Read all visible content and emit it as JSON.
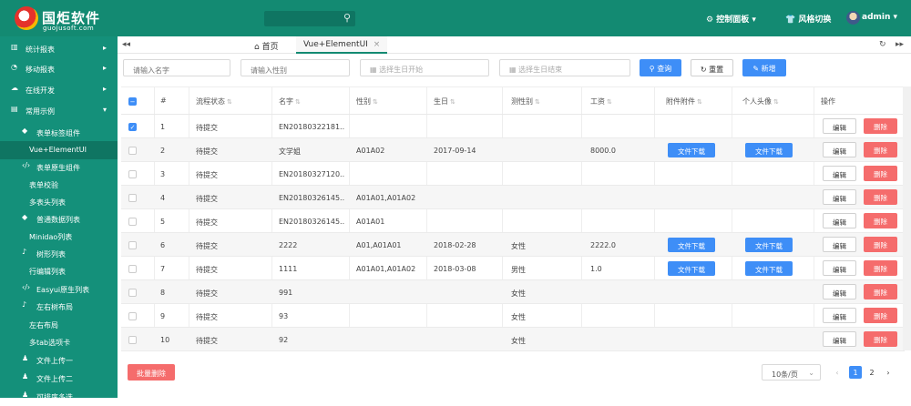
{
  "header": {
    "brand": "国炬软件",
    "brand_sub": "guojusoft.com",
    "search_placeholder": "",
    "control_panel": "控制面板",
    "theme_switch": "风格切换",
    "user": "admin"
  },
  "sidebar": {
    "items": [
      {
        "label": "统计报表",
        "icon": "bar-chart-icon",
        "arrow": "▸"
      },
      {
        "label": "移动报表",
        "icon": "pie-chart-icon",
        "arrow": "▸"
      },
      {
        "label": "在线开发",
        "icon": "cloud-icon",
        "arrow": "▸"
      },
      {
        "label": "常用示例",
        "icon": "folder-icon",
        "arrow": "▾"
      },
      {
        "label": "表单标签组件",
        "icon": "tag-icon"
      },
      {
        "label": "Vue+ElementUI",
        "icon": ""
      },
      {
        "label": "表单原生组件",
        "icon": "code-icon"
      },
      {
        "label": "表单校验",
        "icon": ""
      },
      {
        "label": "多表头列表",
        "icon": ""
      },
      {
        "label": "普通数据列表",
        "icon": "tag-icon"
      },
      {
        "label": "Minidao列表",
        "icon": ""
      },
      {
        "label": "树形列表",
        "icon": "bell-icon"
      },
      {
        "label": "行编辑列表",
        "icon": ""
      },
      {
        "label": "Easyui原生列表",
        "icon": "code-icon"
      },
      {
        "label": "左右树布局",
        "icon": "bell-icon"
      },
      {
        "label": "左右布局",
        "icon": ""
      },
      {
        "label": "多tab选项卡",
        "icon": ""
      },
      {
        "label": "文件上传一",
        "icon": "user-icon"
      },
      {
        "label": "文件上传二",
        "icon": "user-icon"
      },
      {
        "label": "可排序多选",
        "icon": "user-icon"
      }
    ]
  },
  "tabs": {
    "home": "首页",
    "active": "Vue+ElementUI"
  },
  "filters": {
    "name_placeholder": "请输入名字",
    "gender_placeholder": "请输入性别",
    "birth_start_placeholder": "选择生日开始",
    "birth_end_placeholder": "选择生日结束",
    "query": "查询",
    "reset": "重置",
    "add": "新增"
  },
  "table": {
    "headers": [
      "#",
      "流程状态",
      "名字",
      "性别",
      "生日",
      "测性别",
      "工资",
      "附件附件",
      "个人头像",
      "操作"
    ],
    "download_label": "文件下载",
    "edit_label": "编辑",
    "delete_label": "删除",
    "rows": [
      {
        "no": "1",
        "status": "待提交",
        "name": "EN20180322181...",
        "gender": "",
        "birthday": "",
        "sex": "",
        "salary": "",
        "attach": false,
        "avatar": false,
        "checked": true
      },
      {
        "no": "2",
        "status": "待提交",
        "name": "文学姐",
        "gender": "A01A02",
        "birthday": "2017-09-14",
        "sex": "",
        "salary": "8000.0",
        "attach": true,
        "avatar": true,
        "checked": false
      },
      {
        "no": "3",
        "status": "待提交",
        "name": "EN20180327120...",
        "gender": "",
        "birthday": "",
        "sex": "",
        "salary": "",
        "attach": false,
        "avatar": false,
        "checked": false
      },
      {
        "no": "4",
        "status": "待提交",
        "name": "EN20180326145...",
        "gender": "A01A01,A01A02",
        "birthday": "",
        "sex": "",
        "salary": "",
        "attach": false,
        "avatar": false,
        "checked": false
      },
      {
        "no": "5",
        "status": "待提交",
        "name": "EN20180326145...",
        "gender": "A01A01",
        "birthday": "",
        "sex": "",
        "salary": "",
        "attach": false,
        "avatar": false,
        "checked": false
      },
      {
        "no": "6",
        "status": "待提交",
        "name": "2222",
        "gender": "A01,A01A01",
        "birthday": "2018-02-28",
        "sex": "女性",
        "salary": "2222.0",
        "attach": true,
        "avatar": true,
        "checked": false
      },
      {
        "no": "7",
        "status": "待提交",
        "name": "1111",
        "gender": "A01A01,A01A02",
        "birthday": "2018-03-08",
        "sex": "男性",
        "salary": "1.0",
        "attach": true,
        "avatar": true,
        "checked": false
      },
      {
        "no": "8",
        "status": "待提交",
        "name": "991",
        "gender": "",
        "birthday": "",
        "sex": "女性",
        "salary": "",
        "attach": false,
        "avatar": false,
        "checked": false
      },
      {
        "no": "9",
        "status": "待提交",
        "name": "93",
        "gender": "",
        "birthday": "",
        "sex": "女性",
        "salary": "",
        "attach": false,
        "avatar": false,
        "checked": false
      },
      {
        "no": "10",
        "status": "待提交",
        "name": "92",
        "gender": "",
        "birthday": "",
        "sex": "女性",
        "salary": "",
        "attach": false,
        "avatar": false,
        "checked": false
      }
    ]
  },
  "footer": {
    "batch_delete": "批量删除",
    "page_size": "10条/页",
    "pages": [
      "1",
      "2"
    ],
    "current_page": "1"
  },
  "colors": {
    "header": "#138a72",
    "sidebar": "#14907a",
    "primary": "#3e8ef7",
    "danger": "#f56c6c"
  }
}
